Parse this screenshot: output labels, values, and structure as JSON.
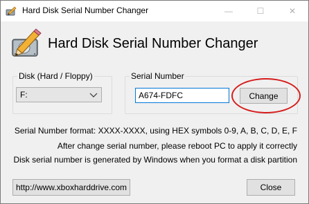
{
  "window": {
    "title": "Hard Disk Serial Number Changer",
    "controls": {
      "minimize": "—",
      "maximize": "☐",
      "close": "✕"
    }
  },
  "header": {
    "heading": "Hard Disk Serial Number Changer",
    "logo_icon": "hard-disk-pencil-icon"
  },
  "disk_group": {
    "label": "Disk (Hard / Floppy)",
    "selected": "F:",
    "chevron_icon": "chevron-down-icon"
  },
  "serial_group": {
    "label": "Serial Number",
    "value": "A674-FDFC",
    "change_label": "Change",
    "highlight_color": "#d61c1c"
  },
  "info": {
    "format_line": "Serial Number format: XXXX-XXXX, using HEX symbols 0-9, A, B, C, D, E, F",
    "reboot_line": "After change serial number, please reboot PC to apply it correctly",
    "generated_line": "Disk serial number is generated by Windows when you format a disk partition"
  },
  "footer": {
    "url_label": "http://www.xboxharddrive.com",
    "close_label": "Close"
  }
}
